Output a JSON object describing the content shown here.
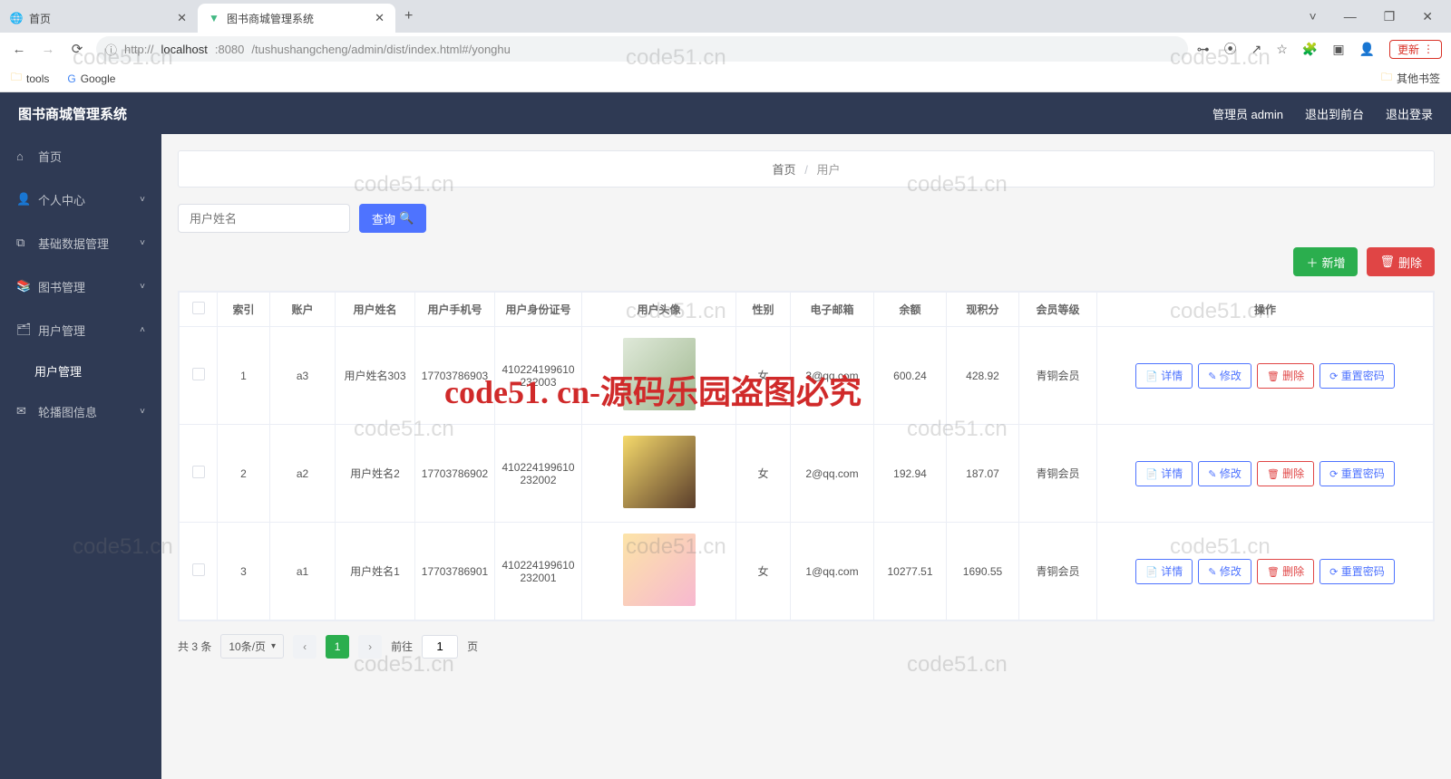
{
  "browser": {
    "tabs": [
      {
        "title": "首页",
        "favicon": "globe"
      },
      {
        "title": "图书商城管理系统",
        "favicon": "vue"
      }
    ],
    "url": {
      "scheme": "http://",
      "host": "localhost",
      "port": ":8080",
      "path": "/tushushangcheng/admin/dist/index.html#/yonghu"
    },
    "update_label": "更新",
    "bookmarks": {
      "tools": "tools",
      "google": "Google",
      "other": "其他书签"
    },
    "win": {
      "dropdown": "˅",
      "min": "—",
      "max": "❐",
      "close": "✕"
    }
  },
  "header": {
    "brand": "图书商城管理系统",
    "admin": "管理员 admin",
    "to_front": "退出到前台",
    "logout": "退出登录"
  },
  "sidebar": {
    "items": [
      {
        "label": "首页",
        "icon": "home"
      },
      {
        "label": "个人中心",
        "icon": "user",
        "expandable": true
      },
      {
        "label": "基础数据管理",
        "icon": "copy",
        "expandable": true
      },
      {
        "label": "图书管理",
        "icon": "book",
        "expandable": true
      },
      {
        "label": "用户管理",
        "icon": "id",
        "expandable": true,
        "expanded": true,
        "sub": [
          {
            "label": "用户管理"
          }
        ]
      },
      {
        "label": "轮播图信息",
        "icon": "mail",
        "expandable": true
      }
    ]
  },
  "breadcrumb": {
    "home": "首页",
    "current": "用户"
  },
  "search": {
    "placeholder": "用户姓名",
    "button": "查询"
  },
  "actions": {
    "add": "新增",
    "delete": "删除"
  },
  "table": {
    "headers": [
      "索引",
      "账户",
      "用户姓名",
      "用户手机号",
      "用户身份证号",
      "用户头像",
      "性别",
      "电子邮箱",
      "余额",
      "现积分",
      "会员等级",
      "操作"
    ],
    "row_buttons": {
      "detail": "详情",
      "edit": "修改",
      "delete": "删除",
      "reset": "重置密码"
    },
    "rows": [
      {
        "idx": "1",
        "account": "a3",
        "name": "用户姓名303",
        "phone": "17703786903",
        "idcard": "410224199610232003",
        "gender": "女",
        "email": "3@qq.com",
        "balance": "600.24",
        "points": "428.92",
        "level": "青铜会员"
      },
      {
        "idx": "2",
        "account": "a2",
        "name": "用户姓名2",
        "phone": "17703786902",
        "idcard": "410224199610232002",
        "gender": "女",
        "email": "2@qq.com",
        "balance": "192.94",
        "points": "187.07",
        "level": "青铜会员"
      },
      {
        "idx": "3",
        "account": "a1",
        "name": "用户姓名1",
        "phone": "17703786901",
        "idcard": "410224199610232001",
        "gender": "女",
        "email": "1@qq.com",
        "balance": "10277.51",
        "points": "1690.55",
        "level": "青铜会员"
      }
    ]
  },
  "pager": {
    "total": "共 3 条",
    "size": "10条/页",
    "current": "1",
    "goto": "前往",
    "page_suffix": "页"
  },
  "watermark": {
    "red": "code51. cn-源码乐园盗图必究",
    "grey": "code51.cn"
  }
}
